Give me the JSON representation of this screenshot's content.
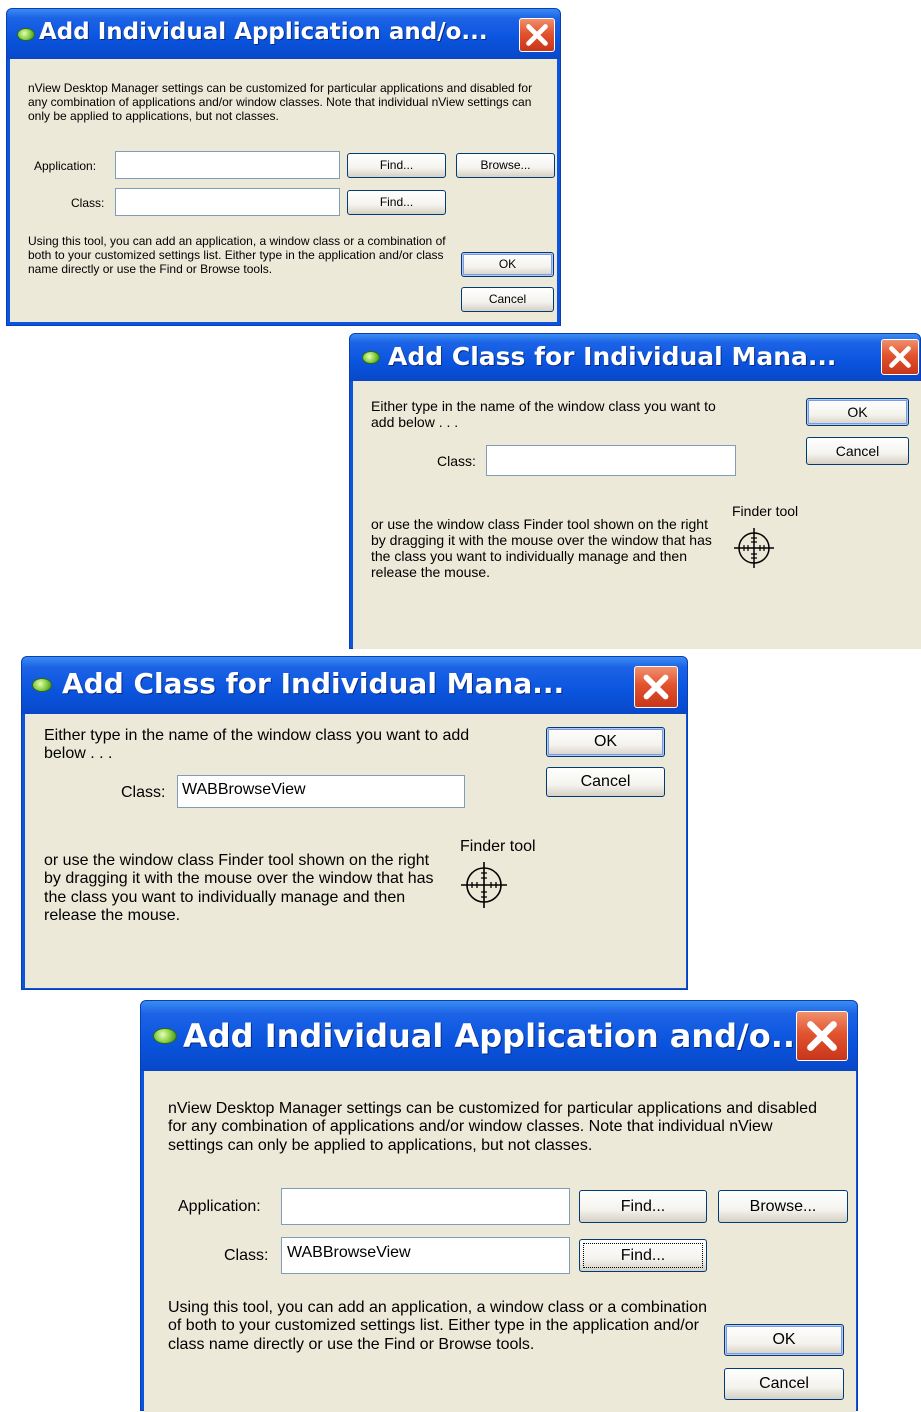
{
  "dialog1": {
    "title": "Add Individual Application and/o...",
    "description": "nView Desktop Manager settings can be customized for particular applications and disabled for any combination of applications and/or window classes. Note that individual nView settings can only be applied to applications, but not classes.",
    "application_label": "Application:",
    "application_value": "",
    "class_label": "Class:",
    "class_value": "",
    "find_app_label": "Find...",
    "browse_label": "Browse...",
    "find_class_label": "Find...",
    "footer_text": "Using this tool, you can add an application, a window class or a combination of both to your customized settings list. Either type in the application and/or class name directly or use the Find or Browse tools.",
    "ok_label": "OK",
    "cancel_label": "Cancel"
  },
  "dialog2": {
    "title": "Add Class for Individual Mana...",
    "intro": "Either type in the name of the window class you want to add below . . .",
    "class_label": "Class:",
    "class_value": "",
    "finder_label": "Finder tool",
    "finder_text": "or use the window class Finder tool shown on the right by dragging it with the mouse over the window that has the class you want to individually manage and then release the mouse.",
    "ok_label": "OK",
    "cancel_label": "Cancel"
  },
  "dialog3": {
    "title": "Add Class for Individual Mana...",
    "intro": "Either type in the name of the window class you want to add below . . .",
    "class_label": "Class:",
    "class_value": "WABBrowseView",
    "finder_label": "Finder tool",
    "finder_text": "or use the window class Finder tool shown on the right by dragging it with the mouse over the window that has the class you want to individually manage and then release the mouse.",
    "ok_label": "OK",
    "cancel_label": "Cancel"
  },
  "dialog4": {
    "title": "Add Individual Application and/o...",
    "description": "nView Desktop Manager settings can be customized for particular applications and disabled for any combination of applications and/or window classes. Note that individual nView settings can only be applied to applications, but not classes.",
    "application_label": "Application:",
    "application_value": "",
    "class_label": "Class:",
    "class_value": "WABBrowseView",
    "find_app_label": "Find...",
    "browse_label": "Browse...",
    "find_class_label": "Find...",
    "footer_text": "Using this tool, you can add an application, a window class or a combination of both to your customized settings list. Either type in the application and/or class name directly or use the Find or Browse tools.",
    "ok_label": "OK",
    "cancel_label": "Cancel"
  },
  "icons": {
    "app_icon": "nvidia-eye-icon",
    "close_icon": "close-x-icon",
    "finder_icon": "crosshair-target-icon"
  },
  "colors": {
    "titlebar": "#0a54de",
    "dialog_face": "#ece9d8",
    "close_button": "#e2532f"
  }
}
